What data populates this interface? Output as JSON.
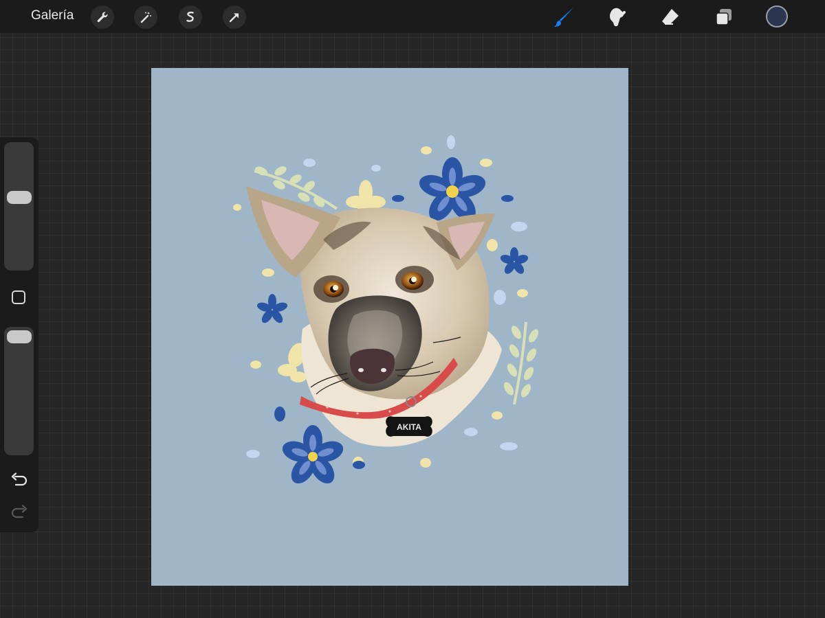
{
  "toolbar": {
    "gallery_label": "Galería",
    "left_tools": [
      "wrench-icon",
      "magic-wand-icon",
      "selection-icon",
      "transform-arrow-icon"
    ],
    "right_tools": [
      "brush-icon",
      "smudge-icon",
      "eraser-icon",
      "layers-icon"
    ],
    "active_tool": "brush-icon",
    "active_tool_color": "#1a7cf5",
    "current_color": "#2b3550"
  },
  "sidebar": {
    "brush_size_fraction": 0.58,
    "opacity_fraction": 1.0,
    "undo_icon": "undo-icon",
    "redo_icon": "redo-icon",
    "redo_enabled": false
  },
  "canvas": {
    "background_color": "#9fb5c8",
    "tag_text": "AKITA"
  }
}
